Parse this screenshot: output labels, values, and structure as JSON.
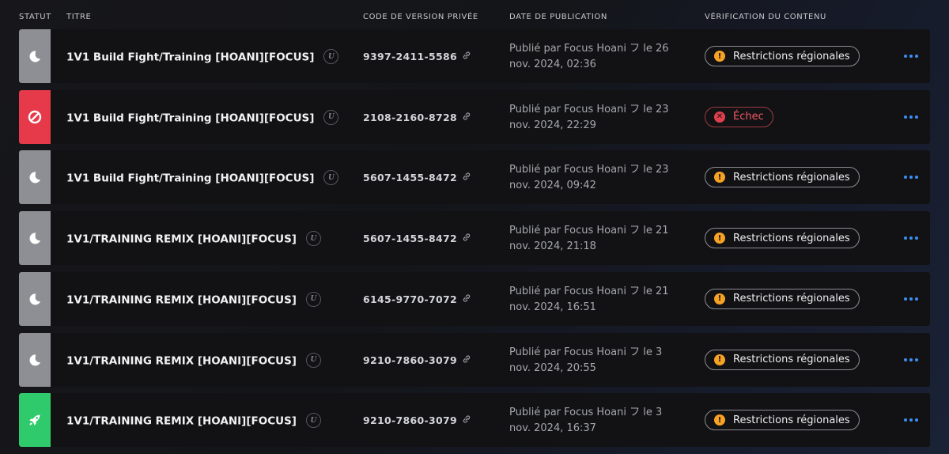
{
  "header": {
    "status": "STATUT",
    "title": "TITRE",
    "code": "CODE DE VERSION PRIVÉE",
    "date": "DATE DE PUBLICATION",
    "verification": "VÉRIFICATION DU CONTENU"
  },
  "colors": {
    "draft": "#8d8f95",
    "failed": "#e63a4a",
    "live": "#2fca6b",
    "warning": "#f6a224",
    "accent": "#3b8ff5"
  },
  "rows": [
    {
      "status": "draft",
      "status_icon": "moon-icon",
      "title": "1V1 Build Fight/Training [HOANI][FOCUS]",
      "engine_badge": "U",
      "code": "9397-2411-5586",
      "published_line1": "Publié par Focus Hoani フ le 26",
      "published_line2": "nov. 2024, 02:36",
      "verification": "Restrictions régionales",
      "verification_type": "warning"
    },
    {
      "status": "failed",
      "status_icon": "blocked-icon",
      "title": "1V1 Build Fight/Training [HOANI][FOCUS]",
      "engine_badge": "U",
      "code": "2108-2160-8728",
      "published_line1": "Publié par Focus Hoani フ le 23",
      "published_line2": "nov. 2024, 22:29",
      "verification": "Échec",
      "verification_type": "fail"
    },
    {
      "status": "draft",
      "status_icon": "moon-icon",
      "title": "1V1 Build Fight/Training [HOANI][FOCUS]",
      "engine_badge": "U",
      "code": "5607-1455-8472",
      "published_line1": "Publié par Focus Hoani フ le 23",
      "published_line2": "nov. 2024, 09:42",
      "verification": "Restrictions régionales",
      "verification_type": "warning"
    },
    {
      "status": "draft",
      "status_icon": "moon-icon",
      "title": "1V1/TRAINING REMIX [HOANI][FOCUS]",
      "engine_badge": "U",
      "code": "5607-1455-8472",
      "published_line1": "Publié par Focus Hoani フ le 21",
      "published_line2": "nov. 2024, 21:18",
      "verification": "Restrictions régionales",
      "verification_type": "warning"
    },
    {
      "status": "draft",
      "status_icon": "moon-icon",
      "title": "1V1/TRAINING REMIX [HOANI][FOCUS]",
      "engine_badge": "U",
      "code": "6145-9770-7072",
      "published_line1": "Publié par Focus Hoani フ le 21",
      "published_line2": "nov. 2024, 16:51",
      "verification": "Restrictions régionales",
      "verification_type": "warning"
    },
    {
      "status": "draft",
      "status_icon": "moon-icon",
      "title": "1V1/TRAINING REMIX [HOANI][FOCUS]",
      "engine_badge": "U",
      "code": "9210-7860-3079",
      "published_line1": "Publié par Focus Hoani フ le 3",
      "published_line2": "nov. 2024, 20:55",
      "verification": "Restrictions régionales",
      "verification_type": "warning"
    },
    {
      "status": "live",
      "status_icon": "rocket-icon",
      "title": "1V1/TRAINING REMIX [HOANI][FOCUS]",
      "engine_badge": "U",
      "code": "9210-7860-3079",
      "published_line1": "Publié par Focus Hoani フ le 3",
      "published_line2": "nov. 2024, 16:37",
      "verification": "Restrictions régionales",
      "verification_type": "warning"
    }
  ]
}
